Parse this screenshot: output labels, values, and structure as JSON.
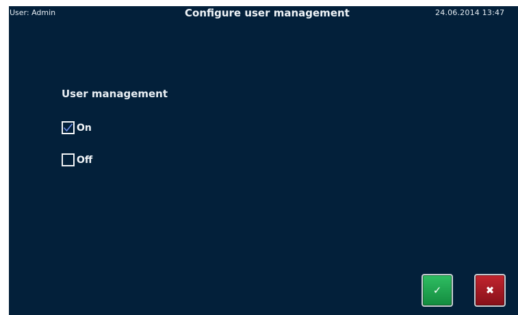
{
  "header": {
    "user": "User: Admin",
    "title": "Configure user management",
    "datetime": "24.06.2014 13:47"
  },
  "user_management": {
    "label": "User management",
    "options": [
      {
        "label": "On",
        "checked": true
      },
      {
        "label": "Off",
        "checked": false
      }
    ]
  },
  "buttons": {
    "confirm_icon": "checkmark-icon",
    "confirm_glyph": "✓",
    "cancel_icon": "cross-icon",
    "cancel_glyph": "✖"
  },
  "colors": {
    "background": "#03203a",
    "confirm": "#1fa84f",
    "cancel": "#a8161f",
    "checkmark": "#6f8fe8"
  }
}
